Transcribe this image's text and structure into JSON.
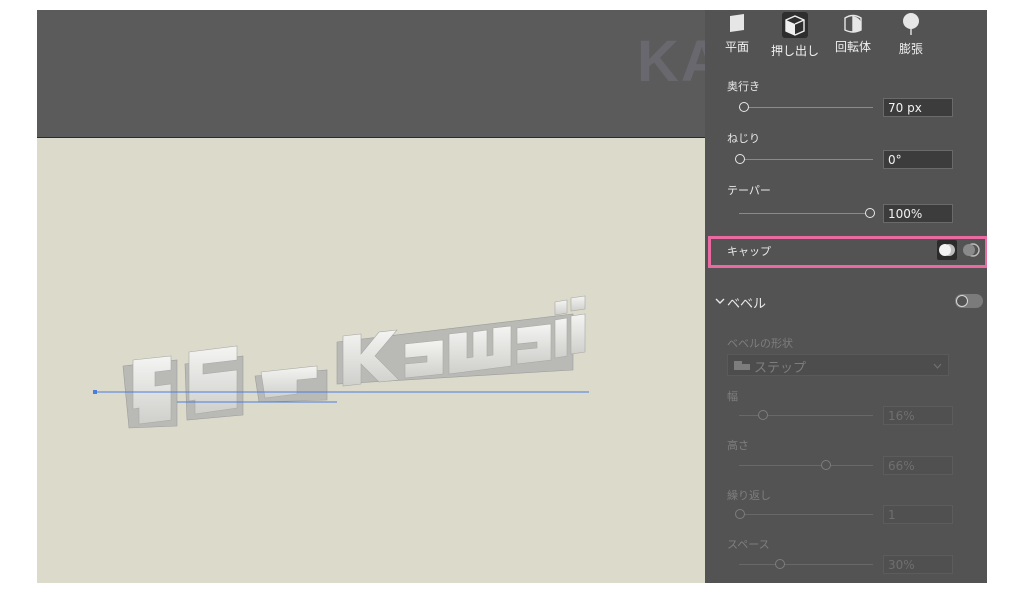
{
  "shape_tabs": [
    {
      "label": "平面",
      "icon": "plane-shape-icon"
    },
    {
      "label": "押し出し",
      "icon": "extrude-cube-icon",
      "active": true
    },
    {
      "label": "回転体",
      "icon": "revolve-icon"
    },
    {
      "label": "膨張",
      "icon": "inflate-balloon-icon"
    }
  ],
  "depth": {
    "label": "奥行き",
    "value": "70 px",
    "slider_fraction": 0.05
  },
  "twist": {
    "label": "ねじり",
    "value": "0°",
    "slider_fraction": 0.0
  },
  "taper": {
    "label": "テーパー",
    "value": "100%",
    "slider_fraction": 1.0
  },
  "cap": {
    "label": "キャップ",
    "icons": [
      "cap-on-icon",
      "cap-off-icon"
    ]
  },
  "bevel": {
    "section_label": "ベベル",
    "enabled": false,
    "shape_label": "ベベルの形状",
    "shape_value": "ステップ",
    "width": {
      "label": "幅",
      "value": "16%",
      "slider_fraction": 0.16
    },
    "height": {
      "label": "高さ",
      "value": "66%",
      "slider_fraction": 0.66
    },
    "repeat": {
      "label": "繰り返し",
      "value": "1",
      "slider_fraction": 0.0
    },
    "space": {
      "label": "スペース",
      "value": "30%",
      "slider_fraction": 0.3
    }
  },
  "artwork_text": "Kawaii",
  "watermark": "KAKETAS",
  "colors": {
    "highlight": "#e96aa1",
    "panel": "#535353",
    "artboard": "#dcdacb",
    "guide": "#4a7de0"
  }
}
